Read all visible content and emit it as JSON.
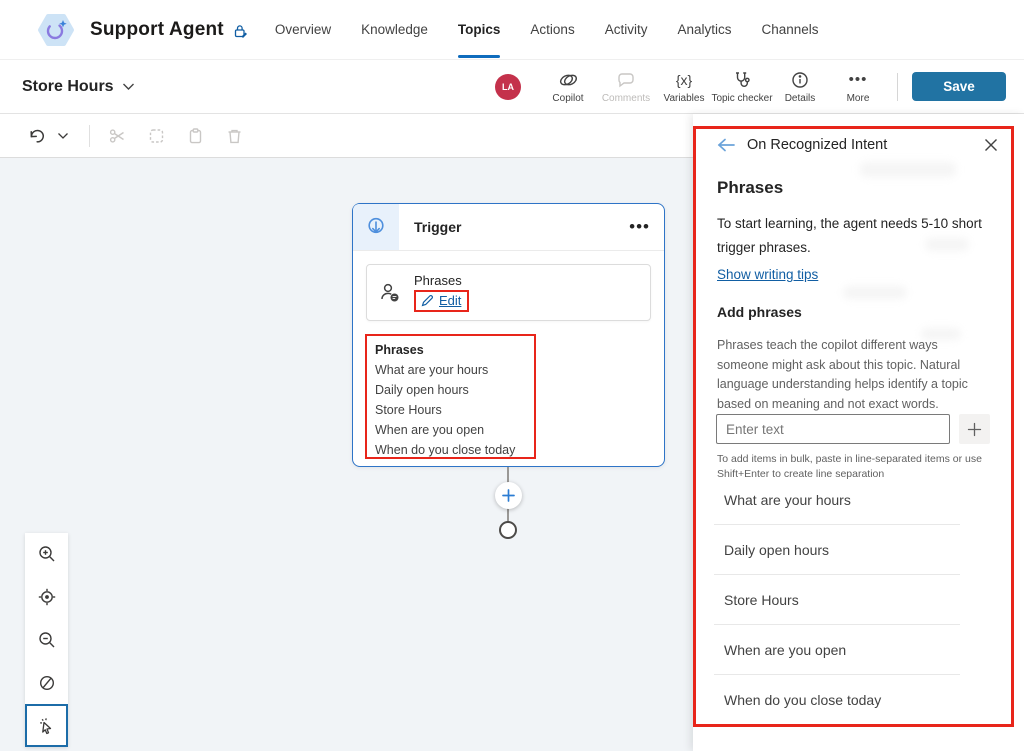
{
  "app": {
    "title": "Support Agent"
  },
  "nav": {
    "tabs": [
      "Overview",
      "Knowledge",
      "Topics",
      "Actions",
      "Activity",
      "Analytics",
      "Channels"
    ],
    "active_tab": "Topics"
  },
  "topic_bar": {
    "title": "Store Hours",
    "avatar_initials": "LA",
    "actions": [
      "Copilot",
      "Comments",
      "Variables",
      "Topic checker",
      "Details",
      "More"
    ],
    "save_label": "Save"
  },
  "canvas": {
    "trigger": {
      "title": "Trigger",
      "more_glyph": "•••",
      "card_label": "Phrases",
      "edit_label": "Edit",
      "phrases_title": "Phrases",
      "phrases": [
        "What are your hours",
        "Daily open hours",
        "Store Hours",
        "When are you open",
        "When do you close today"
      ]
    }
  },
  "panel": {
    "back_title": "On Recognized Intent",
    "heading": "Phrases",
    "intro": "To start learning, the agent needs 5-10 short trigger phrases.",
    "tips_link": "Show writing tips",
    "add_heading": "Add phrases",
    "description": "Phrases teach the copilot different ways someone might ask about this topic. Natural language understanding helps identify a topic based on meaning and not exact words.",
    "input_placeholder": "Enter text",
    "bulk_hint": "To add items in bulk, paste in line-separated items or use Shift+Enter to create line separation",
    "phrases": [
      "What are your hours",
      "Daily open hours",
      "Store Hours",
      "When are you open",
      "When do you close today"
    ]
  },
  "colors": {
    "accent": "#0f6cbd",
    "save_button": "#2173a3",
    "annotation_red": "#e8251a",
    "avatar_red": "#c4314b",
    "link_blue": "#115ea3",
    "node_border_blue": "#2e74c7",
    "canvas_bg": "#f1f4f7"
  }
}
